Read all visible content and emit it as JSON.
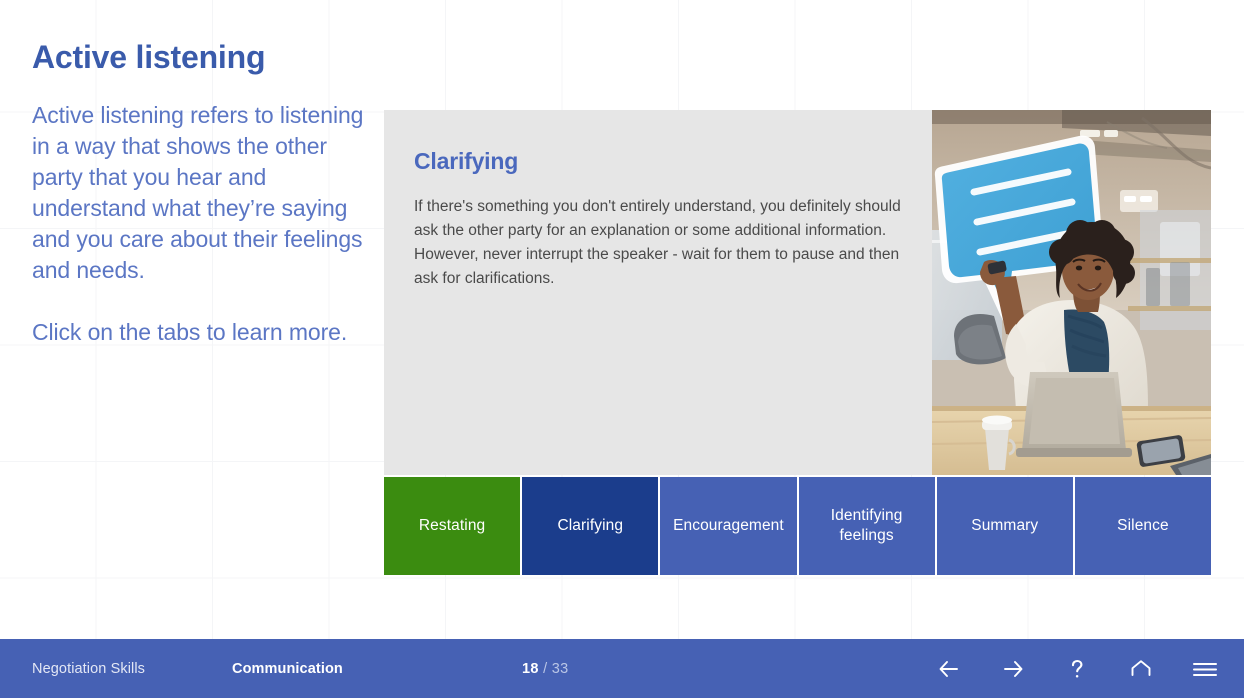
{
  "slide": {
    "title": "Active listening",
    "intro_1": "Active listening refers to listening in a way that shows the other party that you hear and understand what they’re saying and you care about their feelings and needs.",
    "intro_2": "Click on the tabs to learn more."
  },
  "card": {
    "heading": "Clarifying",
    "body": "If there's something you don't entirely understand, you definitely should ask the other party for an explanation or some additional information. However, never interrupt the speaker - wait for them to pause and then ask for clarifications.",
    "photo_alt": "woman-holding-speech-bubble-sign-photo"
  },
  "tabs": [
    {
      "label": "Restating",
      "state": "hover"
    },
    {
      "label": "Clarifying",
      "state": "active"
    },
    {
      "label": "Encouragement",
      "state": "default"
    },
    {
      "label": "Identifying feelings",
      "state": "default"
    },
    {
      "label": "Summary",
      "state": "default"
    },
    {
      "label": "Silence",
      "state": "default"
    }
  ],
  "footer": {
    "course": "Negotiation Skills",
    "section": "Communication",
    "page_current": "18",
    "page_separator": " / ",
    "page_total": "33",
    "nav": [
      {
        "name": "previous-slide-button",
        "icon": "arrow-left-icon"
      },
      {
        "name": "next-slide-button",
        "icon": "arrow-right-icon"
      },
      {
        "name": "help-button",
        "icon": "question-mark-icon"
      },
      {
        "name": "home-button",
        "icon": "home-icon"
      },
      {
        "name": "menu-button",
        "icon": "hamburger-menu-icon"
      }
    ]
  },
  "colors": {
    "brand_blue": "#4661b4",
    "title_blue": "#3a5bab",
    "body_blue": "#5b76c4",
    "tab_active": "#1b3d8c",
    "tab_hover_green": "#3b8c10",
    "card_bg": "#e6e6e6"
  }
}
